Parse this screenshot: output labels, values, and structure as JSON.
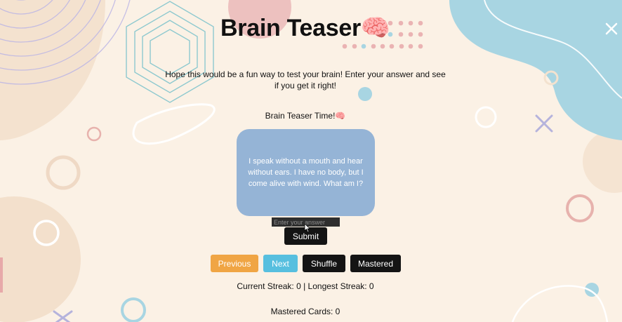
{
  "header": {
    "title": "Brain Teaser🧠"
  },
  "intro": {
    "text": "Hope this would be a fun way to test your brain! Enter your answer and see if you get it right!"
  },
  "quiz": {
    "heading": "Brain Teaser Time!🧠",
    "card_text": "I speak without a mouth and hear without ears. I have no body, but I come alive with wind. What am I?",
    "answer_placeholder": "Enter your answer",
    "submit_label": "Submit"
  },
  "controls": {
    "previous_label": "Previous",
    "next_label": "Next",
    "shuffle_label": "Shuffle",
    "mastered_label": "Mastered"
  },
  "stats": {
    "streak_text": "Current Streak: 0 | Longest Streak: 0",
    "mastered_text": "Mastered Cards: 0"
  },
  "colors": {
    "page_background": "#fbf1e5",
    "card_background": "#95b4d6",
    "previous_button": "#f0a544",
    "next_button": "#57bfdf",
    "dark_button": "#141414"
  },
  "icons": {
    "close": "close-icon",
    "cursor": "mouse-cursor-icon"
  }
}
